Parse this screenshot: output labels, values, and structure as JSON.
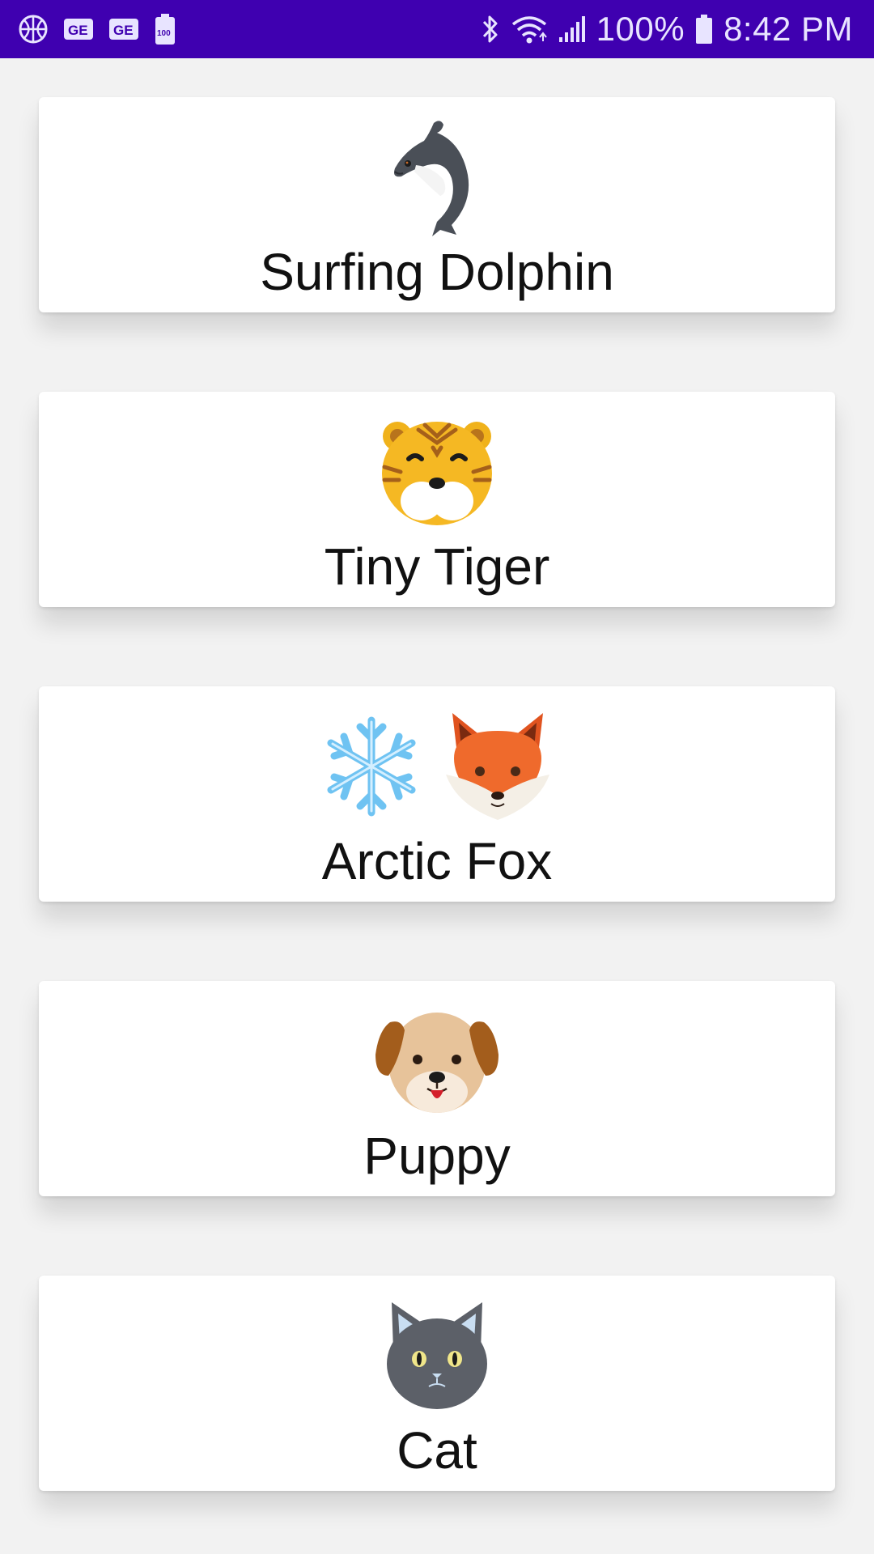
{
  "status_bar": {
    "battery_percent": "100%",
    "time": "8:42 PM",
    "left_icons": [
      "basketball-icon",
      "ge-badge-icon",
      "ge-badge-icon",
      "battery-100-icon"
    ],
    "right_icons": [
      "bluetooth-icon",
      "wifi-icon",
      "signal-icon",
      "battery-icon"
    ],
    "background": "#3f00b0"
  },
  "cards": [
    {
      "title": "Surfing Dolphin",
      "icons": [
        "dolphin-icon"
      ]
    },
    {
      "title": "Tiny Tiger",
      "icons": [
        "tiger-face-icon"
      ]
    },
    {
      "title": "Arctic Fox",
      "icons": [
        "snowflake-icon",
        "fox-face-icon"
      ]
    },
    {
      "title": "Puppy",
      "icons": [
        "dog-face-icon"
      ]
    },
    {
      "title": "Cat",
      "icons": [
        "cat-face-icon"
      ]
    }
  ]
}
